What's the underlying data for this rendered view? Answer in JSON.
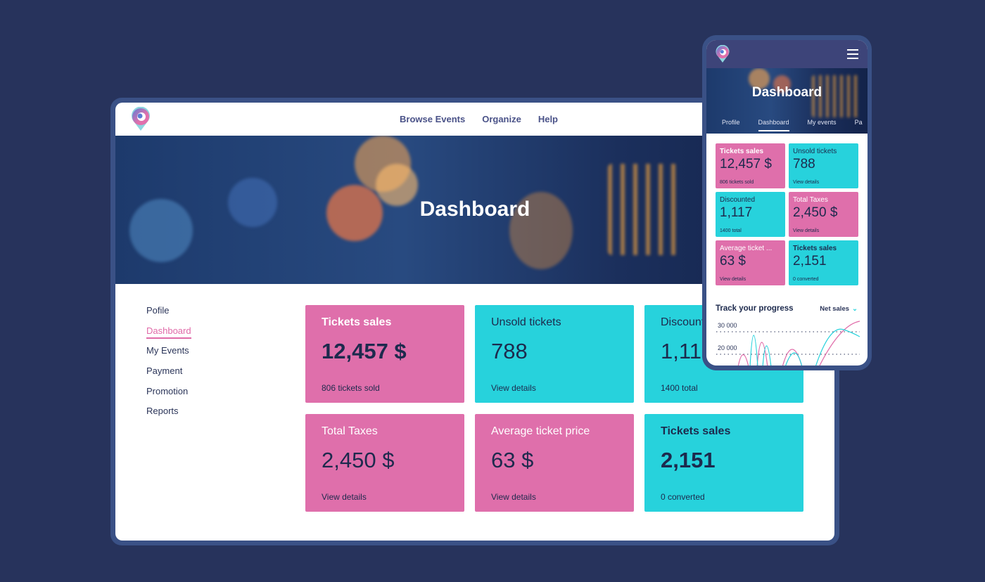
{
  "desktop": {
    "nav": [
      "Browse Events",
      "Organize",
      "Help"
    ],
    "hero_title": "Dashboard",
    "sidebar": [
      {
        "label": "Pofile"
      },
      {
        "label": "Dashboard",
        "active": true
      },
      {
        "label": "My Events"
      },
      {
        "label": "Payment"
      },
      {
        "label": "Promotion"
      },
      {
        "label": "Reports"
      }
    ],
    "cards": [
      {
        "title": "Tickets sales",
        "value": "12,457 $",
        "sub": "806 tickets sold",
        "color": "pink",
        "bold": true
      },
      {
        "title": "Unsold tickets",
        "value": "788",
        "sub": "View details",
        "color": "cyan"
      },
      {
        "title": "Discounted",
        "value": "1,117",
        "sub": "1400 total",
        "color": "cyan"
      },
      {
        "title": "Total Taxes",
        "value": "2,450 $",
        "sub": "View details",
        "color": "pink"
      },
      {
        "title": "Average ticket price",
        "value": "63 $",
        "sub": "View details",
        "color": "pink"
      },
      {
        "title": "Tickets sales",
        "value": "2,151",
        "sub": "0 converted",
        "color": "cyan",
        "bold": true
      }
    ]
  },
  "mobile": {
    "hero_title": "Dashboard",
    "tabs": [
      "Profile",
      "Dashboard",
      "My events",
      "Pa"
    ],
    "active_tab": "Dashboard",
    "cards": [
      {
        "title": "Tickets sales",
        "value": "12,457 $",
        "sub": "806 tickets sold",
        "color": "pink",
        "bold": true
      },
      {
        "title": "Unsold tickets",
        "value": "788",
        "sub": "View details",
        "color": "cyan"
      },
      {
        "title": "Discounted",
        "value": "1,117",
        "sub": "1400 total",
        "color": "cyan"
      },
      {
        "title": "Total Taxes",
        "value": "2,450 $",
        "sub": "View details",
        "color": "pink"
      },
      {
        "title": "Average ticket ...",
        "value": "63 $",
        "sub": "View details",
        "color": "pink"
      },
      {
        "title": "Tickets sales",
        "value": "2,151",
        "sub": "0 converted",
        "color": "cyan",
        "bold": true
      }
    ],
    "progress_title": "Track your progress",
    "progress_select": "Net sales",
    "chart_y_ticks": [
      "30 000",
      "20 000"
    ]
  },
  "colors": {
    "background": "#27335c",
    "pink": "#df6fab",
    "cyan": "#27d2dc",
    "text": "#1d2a4d",
    "mobile_header": "#3d4479"
  },
  "icons": {
    "logo": "location-pin-swirl-logo",
    "menu": "hamburger-menu-icon",
    "select": "chevron-down-icon"
  }
}
